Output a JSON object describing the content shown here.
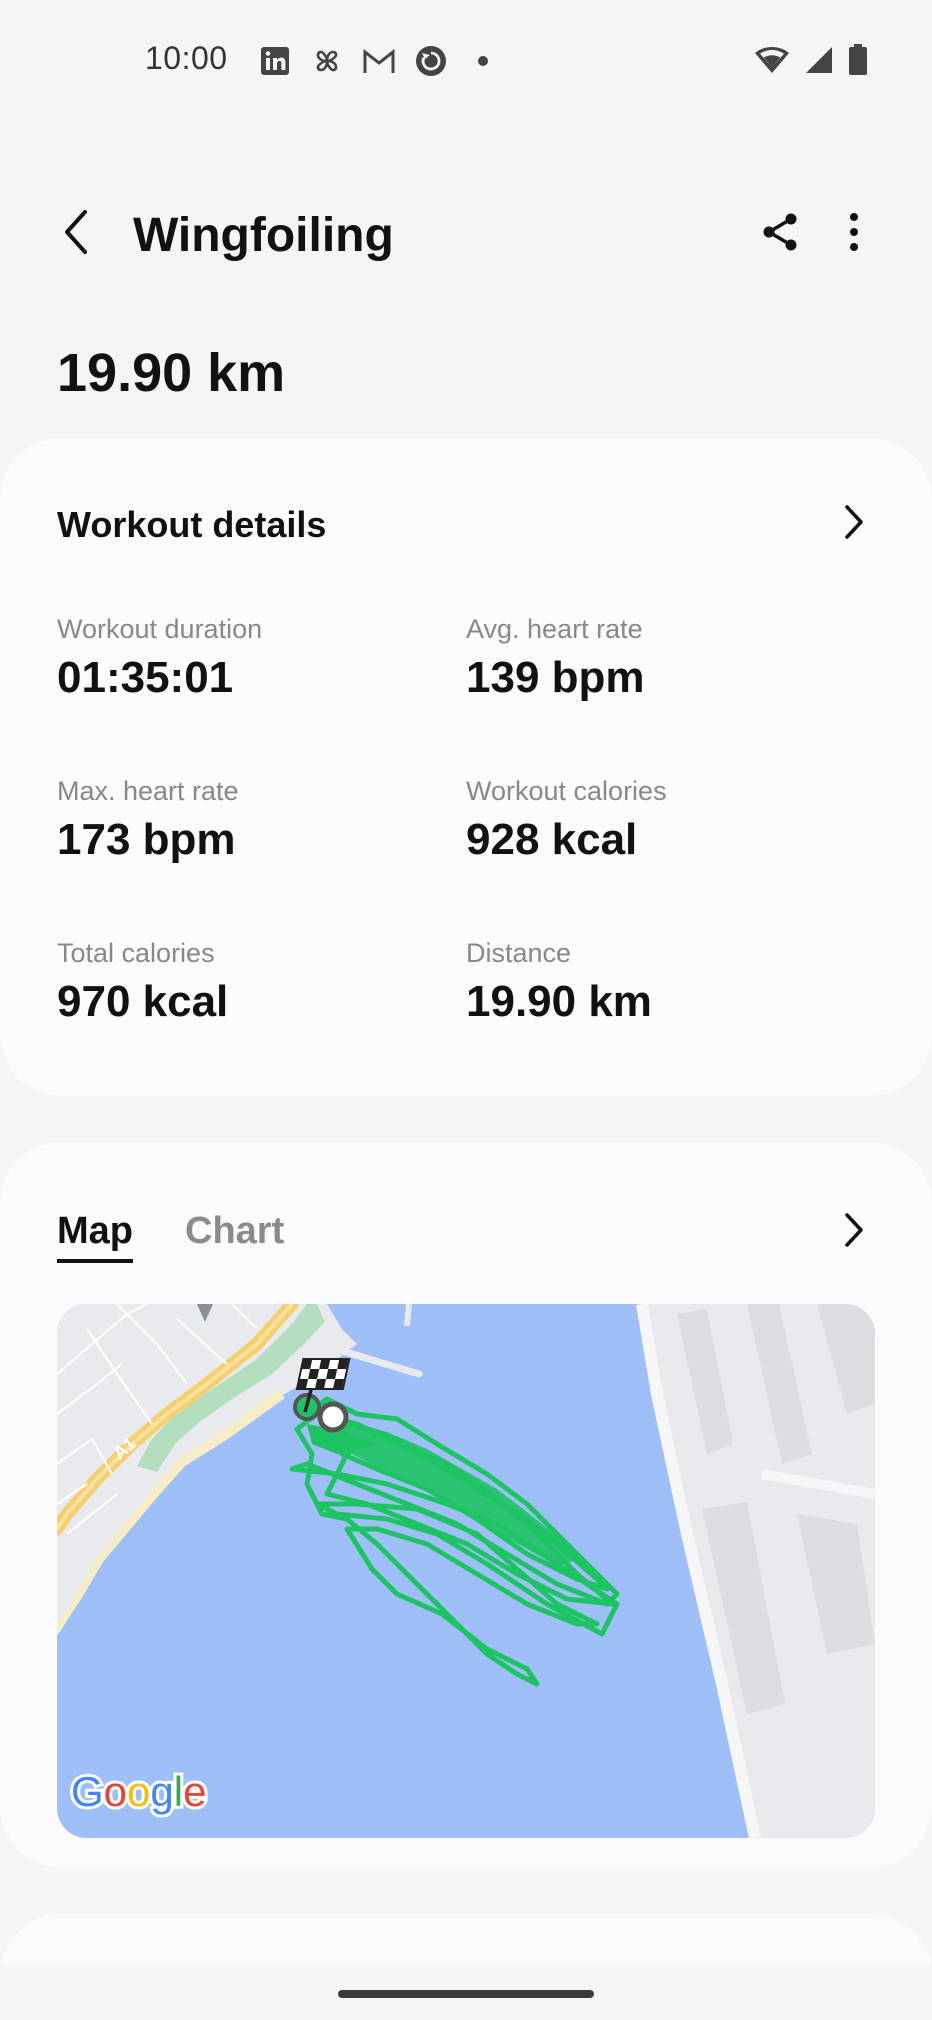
{
  "status_bar": {
    "time": "10:00",
    "left_icons": [
      "linkedin-icon",
      "pinwheel-icon",
      "gmail-icon",
      "sync-icon",
      "dot-icon"
    ],
    "right_icons": [
      "wifi-icon",
      "signal-icon",
      "battery-icon"
    ]
  },
  "app_bar": {
    "title": "Wingfoiling",
    "back_icon": "back-arrow-icon",
    "share_icon": "share-icon",
    "more_icon": "more-vertical-icon"
  },
  "headline": "19.90 km",
  "workout_details": {
    "title": "Workout details",
    "metrics": [
      {
        "label": "Workout duration",
        "value": "01:35:01"
      },
      {
        "label": "Avg. heart rate",
        "value": "139 bpm"
      },
      {
        "label": "Max. heart rate",
        "value": "173 bpm"
      },
      {
        "label": "Workout calories",
        "value": "928 kcal"
      },
      {
        "label": "Total calories",
        "value": "970 kcal"
      },
      {
        "label": "Distance",
        "value": "19.90 km"
      }
    ]
  },
  "map_card": {
    "tabs": [
      {
        "label": "Map",
        "active": true
      },
      {
        "label": "Chart",
        "active": false
      }
    ],
    "road_label": "A1",
    "attribution": "Google",
    "colors": {
      "water": "#9ebff7",
      "land": "#e9eaee",
      "route": "#1ec463",
      "highway": "#f6cf6e",
      "park": "#b4dfbf"
    }
  }
}
